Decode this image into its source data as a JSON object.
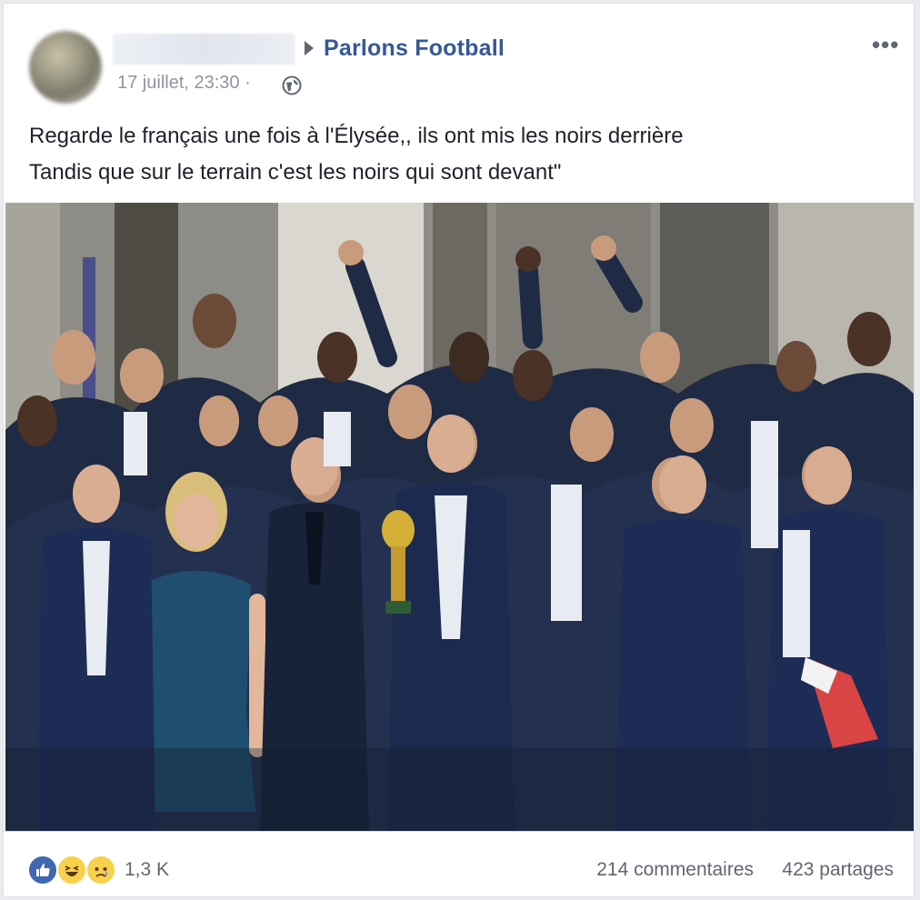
{
  "post": {
    "page_name": "Parlons Football",
    "timestamp": "17 juillet, 23:30 ·",
    "text_line_1": "Regarde le français une fois à l'Élysée,, ils ont mis les noirs derrière",
    "text_line_2": "Tandis que sur le terrain c'est les noirs qui sont devant\"",
    "photo_alt": "Group photo at the Élysée"
  },
  "footer": {
    "reaction_count": "1,3 K",
    "comments": "214 commentaires",
    "shares": "423 partages"
  },
  "icons": {
    "arrow": "triangle-right-icon",
    "privacy": "globe-icon",
    "more": "more-options-icon",
    "reactions": [
      "like-icon",
      "haha-icon",
      "sad-icon"
    ]
  },
  "colors": {
    "link_blue": "#365899",
    "meta_gray": "#90949c",
    "text": "#1d2129",
    "like_blue": "#4267b2",
    "emoji_yellow": "#f7d14b"
  }
}
